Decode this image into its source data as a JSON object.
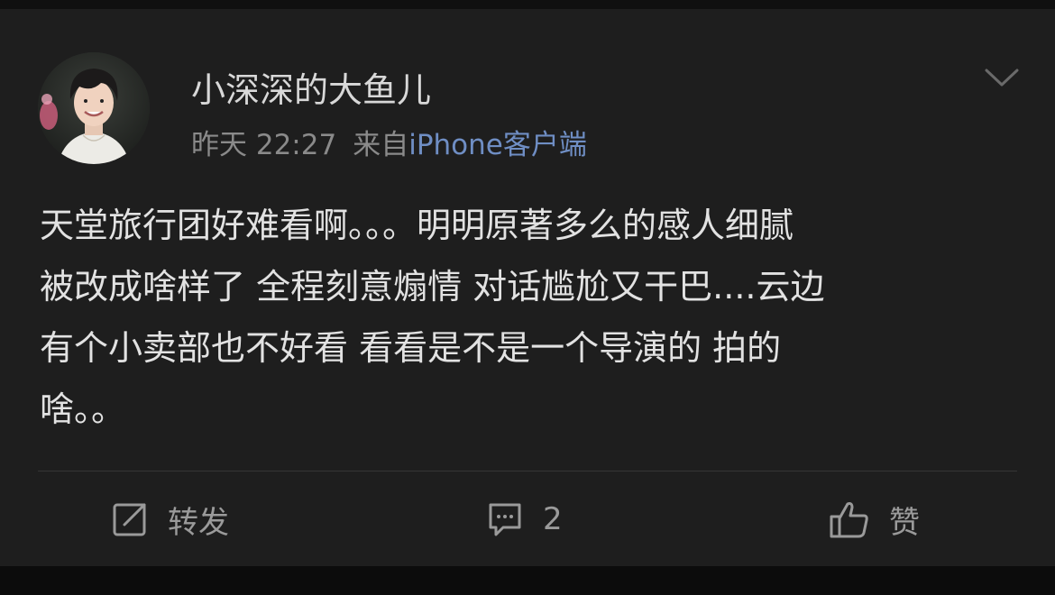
{
  "post": {
    "author": "小深深的大鱼儿",
    "time": "昨天 22:27",
    "source_prefix": "来自",
    "source_name": "iPhone客户端",
    "text": "天堂旅行团好难看啊。。。明明原著多么的感人细腻\n被改成啥样了 全程刻意煽情 对话尴尬又干巴....云边\n有个小卖部也不好看 看看是不是一个导演的 拍的\n啥。。"
  },
  "actions": {
    "repost_label": "转发",
    "comment_count": "2",
    "like_label": "赞"
  },
  "icons": {
    "menu": "chevron-down-icon",
    "repost": "repost-icon",
    "comment": "comment-icon",
    "like": "thumbs-up-icon"
  },
  "colors": {
    "background": "#1e1e1e",
    "text": "#e2e2e2",
    "muted": "#8a8a8a",
    "link": "#6f8ec4"
  }
}
